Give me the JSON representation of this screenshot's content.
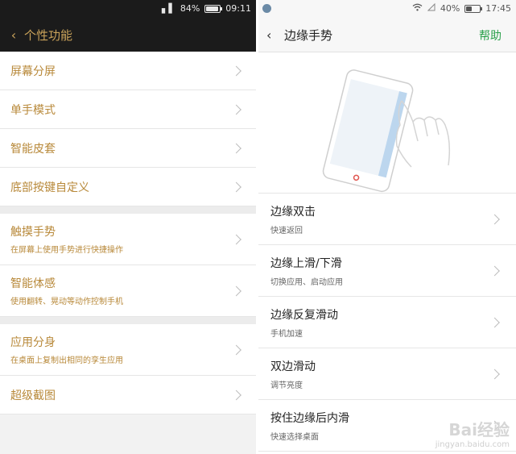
{
  "left": {
    "status": {
      "signal": "▖▌",
      "battery_pct": "84%",
      "battery_level": 0.84,
      "time": "09:11"
    },
    "header": {
      "back": "‹",
      "title": "个性功能"
    },
    "groups": [
      [
        {
          "title": "屏幕分屏"
        },
        {
          "title": "单手模式"
        },
        {
          "title": "智能皮套"
        },
        {
          "title": "底部按键自定义"
        }
      ],
      [
        {
          "title": "触摸手势",
          "subtitle": "在屏幕上使用手势进行快捷操作"
        },
        {
          "title": "智能体感",
          "subtitle": "使用翻转、晃动等动作控制手机"
        }
      ],
      [
        {
          "title": "应用分身",
          "subtitle": "在桌面上复制出相同的孪生应用"
        },
        {
          "title": "超级截图"
        }
      ]
    ]
  },
  "right": {
    "status": {
      "battery_pct": "40%",
      "battery_level": 0.4,
      "time": "17:45"
    },
    "header": {
      "back": "‹",
      "title": "边缘手势",
      "help": "帮助"
    },
    "rows": [
      {
        "title": "边缘双击",
        "subtitle": "快速返回"
      },
      {
        "title": "边缘上滑/下滑",
        "subtitle": "切换应用、启动应用"
      },
      {
        "title": "边缘反复滑动",
        "subtitle": "手机加速"
      },
      {
        "title": "双边滑动",
        "subtitle": "调节亮度"
      },
      {
        "title": "按住边缘后内滑",
        "subtitle": "快速选择桌面"
      }
    ]
  },
  "watermark": {
    "logo": "Bai经验",
    "url": "jingyan.baidu.com"
  }
}
